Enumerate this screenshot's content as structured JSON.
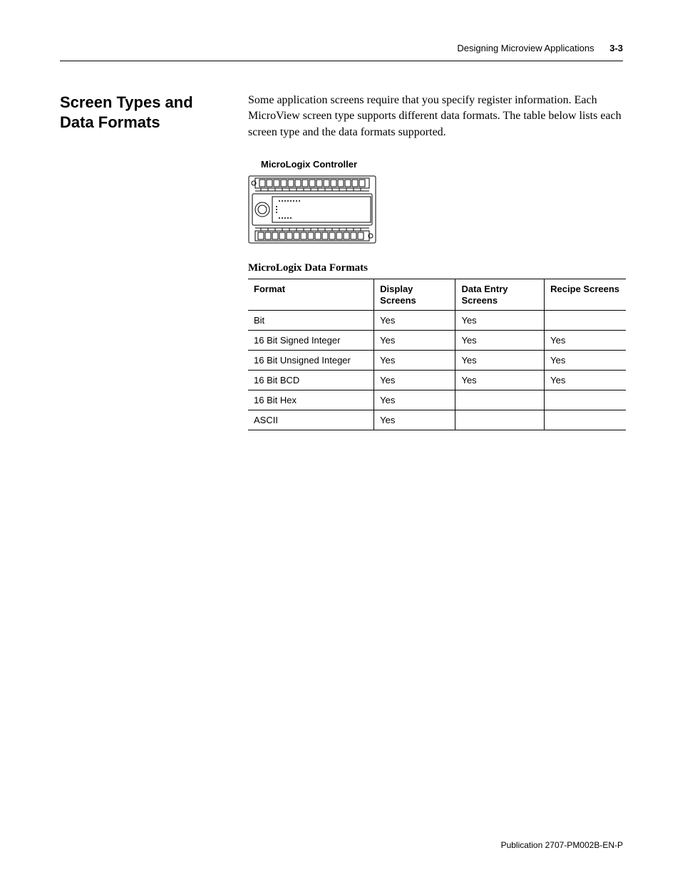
{
  "header": {
    "title": "Designing Microview Applications",
    "page_number": "3-3"
  },
  "side_heading": "Screen Types and Data Formats",
  "intro": "Some application screens require that you specify register information. Each MicroView screen type supports different data formats. The table below lists each screen type and the data formats supported.",
  "figure": {
    "caption": "MicroLogix Controller"
  },
  "table": {
    "title": "MicroLogix Data Formats",
    "columns": {
      "format": "Format",
      "display": "Display Screens",
      "entry": "Data Entry Screens",
      "recipe": "Recipe Screens"
    },
    "rows": [
      {
        "format": "Bit",
        "display": "Yes",
        "entry": "Yes",
        "recipe": ""
      },
      {
        "format": "16 Bit Signed Integer",
        "display": "Yes",
        "entry": "Yes",
        "recipe": "Yes"
      },
      {
        "format": "16 Bit Unsigned Integer",
        "display": "Yes",
        "entry": "Yes",
        "recipe": "Yes"
      },
      {
        "format": "16 Bit BCD",
        "display": "Yes",
        "entry": "Yes",
        "recipe": "Yes"
      },
      {
        "format": "16 Bit Hex",
        "display": "Yes",
        "entry": "",
        "recipe": ""
      },
      {
        "format": "ASCII",
        "display": "Yes",
        "entry": "",
        "recipe": ""
      }
    ]
  },
  "footer": {
    "publication": "Publication 2707-PM002B-EN-P"
  }
}
